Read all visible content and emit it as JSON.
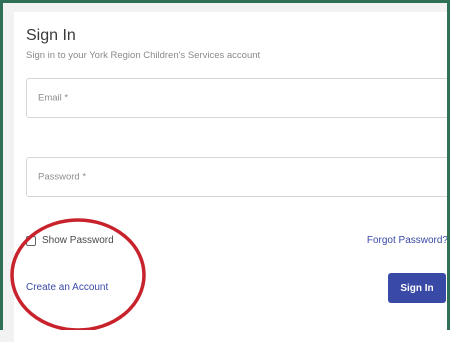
{
  "signin": {
    "title": "Sign In",
    "subtitle": "Sign in to your York Region Children's Services account",
    "email_placeholder": "Email *",
    "password_placeholder": "Password *",
    "show_password_label": "Show Password",
    "forgot_password_label": "Forgot Password?",
    "create_account_label": "Create an Account",
    "signin_button_label": "Sign In"
  },
  "colors": {
    "frame": "#2f6f55",
    "link": "#3b4aa8",
    "button": "#3949a6",
    "highlight_circle": "#c8232c"
  }
}
